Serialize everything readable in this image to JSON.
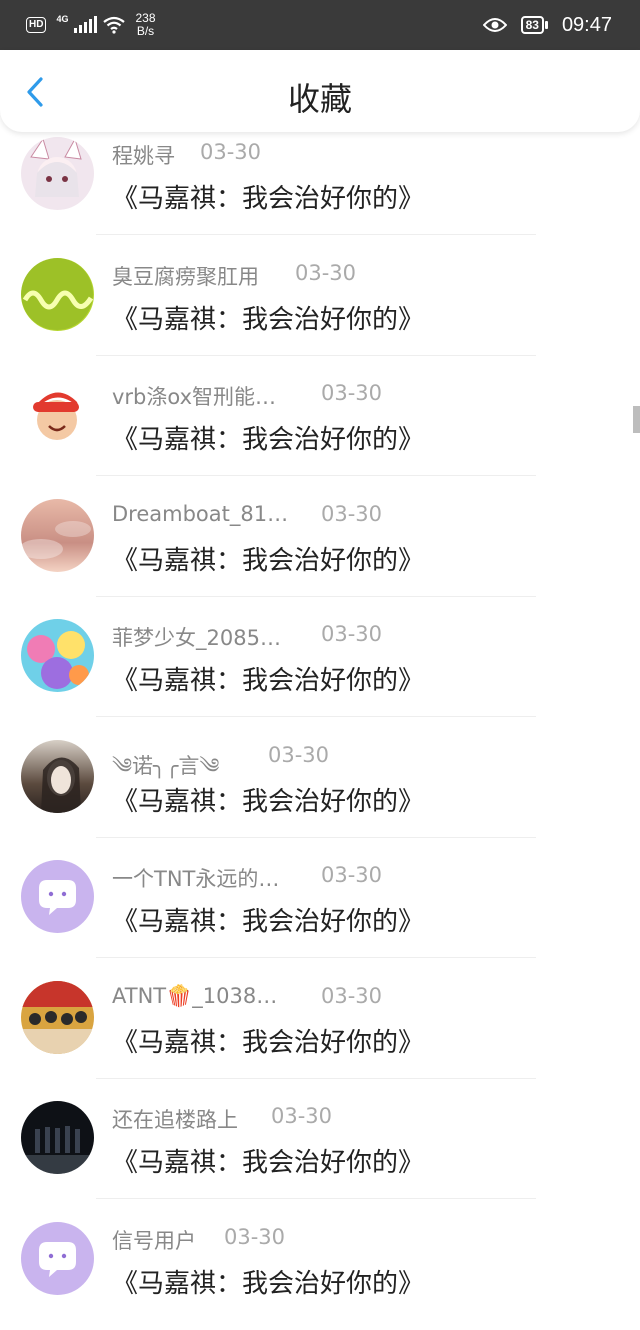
{
  "status": {
    "hd": "HD",
    "net": "4G",
    "speed_value": "238",
    "speed_unit": "B/s",
    "battery": "83",
    "time": "09:47"
  },
  "header": {
    "title": "收藏"
  },
  "items": [
    {
      "name": "程姚寻",
      "date": "03-30",
      "message": "《马嘉祺：我会治好你的》"
    },
    {
      "name": "臭豆腐痨聚肛用",
      "date": "03-30",
      "message": "《马嘉祺：我会治好你的》"
    },
    {
      "name": "vrb涤ox智刑能…",
      "date": "03-30",
      "message": "《马嘉祺：我会治好你的》"
    },
    {
      "name": "Dreamboat_81…",
      "date": "03-30",
      "message": "《马嘉祺：我会治好你的》"
    },
    {
      "name": "菲梦少女_2085…",
      "date": "03-30",
      "message": "《马嘉祺：我会治好你的》"
    },
    {
      "name": "༄诺╮╭言༄",
      "date": "03-30",
      "message": "《马嘉祺：我会治好你的》"
    },
    {
      "name": "一个TNT永远的…",
      "date": "03-30",
      "message": "《马嘉祺：我会治好你的》"
    },
    {
      "name": "ATNT🍿_1038…",
      "date": "03-30",
      "message": "《马嘉祺：我会治好你的》"
    },
    {
      "name": "还在追楼路上",
      "date": "03-30",
      "message": "《马嘉祺：我会治好你的》"
    },
    {
      "name": "信号用户",
      "date": "03-30",
      "message": "《马嘉祺：我会治好你的》"
    }
  ],
  "avatars": [
    {
      "icon": "anime-girl-avatar",
      "colors": [
        "#f1e6ee",
        "#c98aa2",
        "#7a3344"
      ]
    },
    {
      "icon": "lemon-slice-avatar",
      "colors": [
        "#b6d630",
        "#6f9c18",
        "#f7ffb0"
      ]
    },
    {
      "icon": "cartoon-boy-avatar",
      "colors": [
        "#ffffff",
        "#e23a2e",
        "#f4c9a4"
      ]
    },
    {
      "icon": "sunset-sky-avatar",
      "colors": [
        "#e8b9a8",
        "#c98f84",
        "#f4d3c4"
      ]
    },
    {
      "icon": "anime-group-avatar",
      "colors": [
        "#6fd0e8",
        "#f07cb5",
        "#ffe16a"
      ]
    },
    {
      "icon": "portrait-photo-avatar",
      "colors": [
        "#d7cfc6",
        "#5b4a3e",
        "#2b2320"
      ]
    },
    {
      "icon": "default-chat-avatar",
      "colors": [
        "#c9b4ee",
        "#ffffff",
        "#8f6dd4"
      ]
    },
    {
      "icon": "group-photo-avatar",
      "colors": [
        "#d9a440",
        "#c7352b",
        "#2a2a2a"
      ]
    },
    {
      "icon": "stage-photo-avatar",
      "colors": [
        "#0e1116",
        "#3a4250",
        "#6e7a88"
      ]
    },
    {
      "icon": "default-chat-avatar",
      "colors": [
        "#c9b4ee",
        "#ffffff",
        "#8f6dd4"
      ]
    }
  ],
  "accent": "#2f9bea"
}
